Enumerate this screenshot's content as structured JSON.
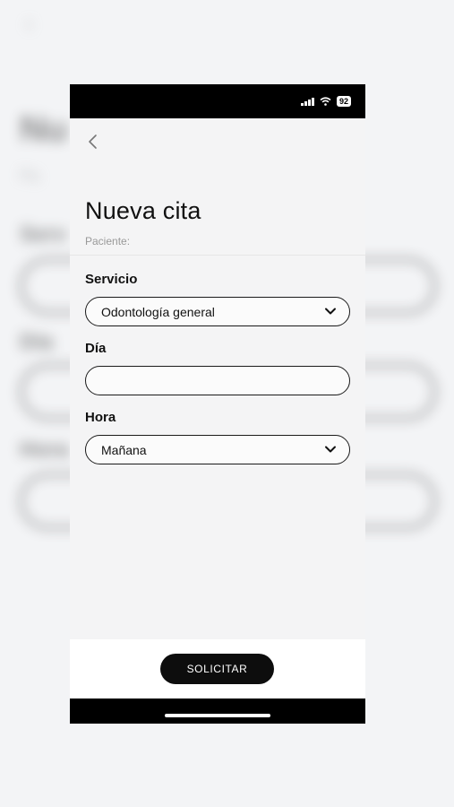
{
  "status_bar": {
    "battery": "92"
  },
  "page": {
    "title": "Nueva cita",
    "patient_label": "Paciente:"
  },
  "form": {
    "service": {
      "label": "Servicio",
      "value": "Odontología general"
    },
    "day": {
      "label": "Día",
      "value": ""
    },
    "time": {
      "label": "Hora",
      "value": "Mañana"
    }
  },
  "actions": {
    "submit_label": "SOLICITAR"
  }
}
